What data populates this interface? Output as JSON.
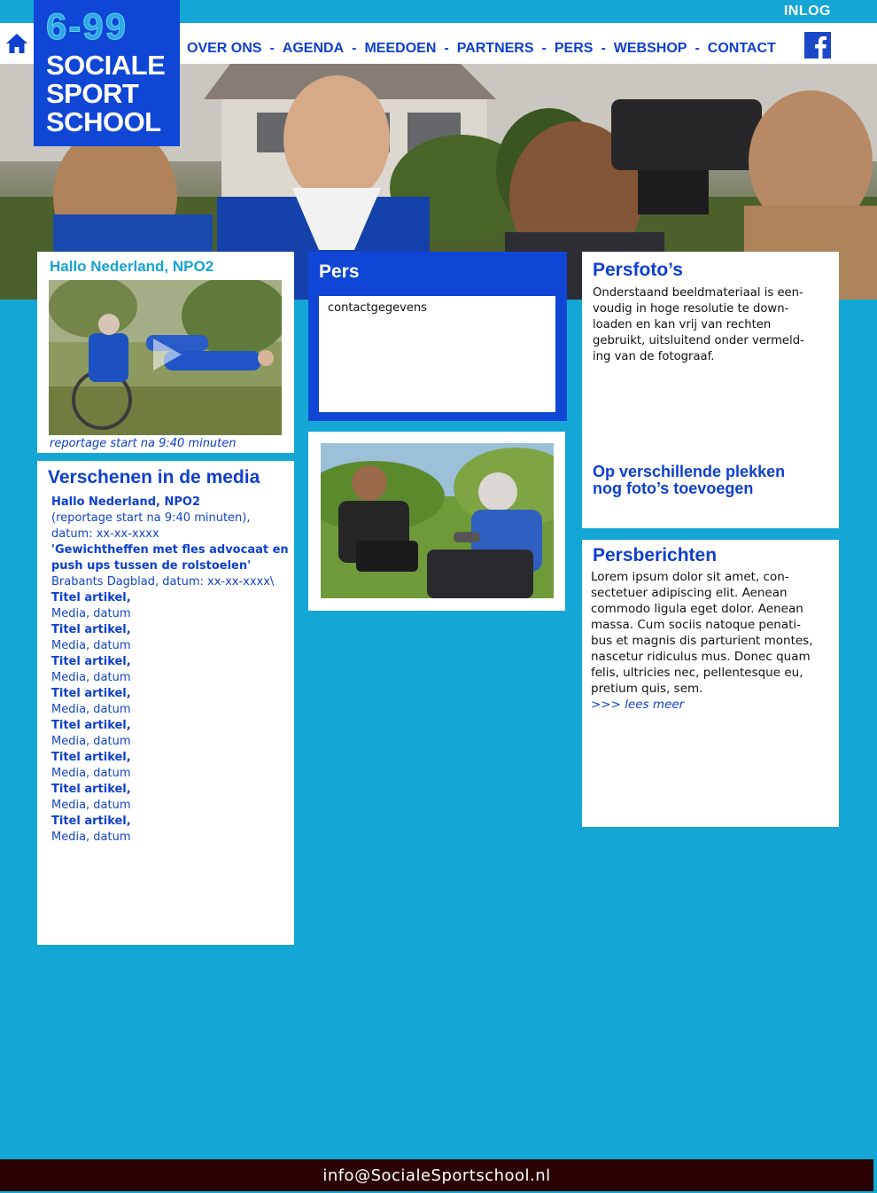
{
  "header": {
    "login": "INLOG",
    "logo": {
      "number": "6-99",
      "line1": "SOCIALE",
      "line2": "SPORT",
      "line3": "SCHOOL"
    },
    "nav": [
      "OVER ONS",
      "AGENDA",
      "MEEDOEN",
      "PARTNERS",
      "PERS",
      "WEBSHOP",
      "CONTACT"
    ],
    "nav_separator": "-",
    "icons": {
      "home": "home-icon",
      "facebook": "facebook-icon"
    }
  },
  "video": {
    "title": "Hallo Nederland, NPO2",
    "caption": "reportage start na 9:40 minuten"
  },
  "media": {
    "title": "Verschenen in de media",
    "first": {
      "title": "Hallo Nederland, NPO2",
      "line1": "(reportage start na 9:40 minuten),",
      "line2": "datum: xx-xx-xxxx"
    },
    "second": {
      "title_line1": "'Gewichtheffen met fles advocaat en",
      "title_line2": "push ups tussen de rolstoelen'",
      "meta": "Brabants Dagblad, datum: xx-xx-xxxx\\"
    },
    "items": [
      {
        "title": "Titel artikel,",
        "meta": "Media, datum"
      },
      {
        "title": "Titel artikel,",
        "meta": "Media, datum"
      },
      {
        "title": "Titel artikel,",
        "meta": "Media, datum"
      },
      {
        "title": "Titel artikel,",
        "meta": "Media, datum"
      },
      {
        "title": "Titel artikel,",
        "meta": "Media, datum"
      },
      {
        "title": "Titel artikel,",
        "meta": "Media, datum"
      },
      {
        "title": "Titel artikel,",
        "meta": "Media, datum"
      },
      {
        "title": "Titel artikel,",
        "meta": "Media, datum"
      }
    ]
  },
  "pers": {
    "title": "Pers",
    "contact_text": "contactgegevens"
  },
  "persfotos": {
    "title": "Persfoto’s",
    "body_lines": [
      "Onderstaand beeldmateriaal is een-",
      "voudig in hoge resolutie te down-",
      "loaden en kan vrij van rechten",
      "gebruikt, uitsluitend onder vermeld-",
      "ing van de fotograaf."
    ],
    "note_line1": "Op verschillende plekken",
    "note_line2": "nog foto’s toevoegen"
  },
  "persberichten": {
    "title": "Persberichten",
    "body_lines": [
      "Lorem ipsum dolor sit amet, con-",
      "sectetuer adipiscing elit. Aenean",
      "commodo ligula eget dolor. Aenean",
      "massa. Cum sociis natoque penati-",
      "bus et magnis dis parturient montes,",
      "nascetur ridiculus mus. Donec quam",
      "felis, ultricies nec, pellentesque eu,",
      "pretium quis, sem."
    ],
    "read_more": ">>> lees meer"
  },
  "footer": {
    "email": "info@SocialeSportschool.nl"
  }
}
